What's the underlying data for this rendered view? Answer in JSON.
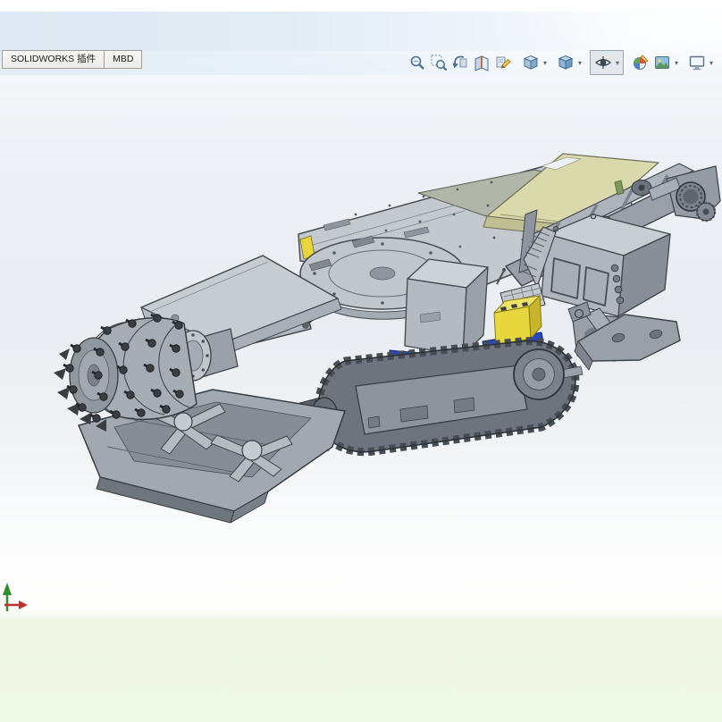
{
  "app": {
    "name": "SOLIDWORKS"
  },
  "command_tabs": {
    "plugins_tab": "SOLIDWORKS 插件",
    "mbd_tab": "MBD"
  },
  "headsup_toolbar": {
    "icons": [
      "zoom-to-fit",
      "zoom-to-area",
      "previous-view",
      "section-view",
      "annotation-views",
      "view-orientation",
      "display-style",
      "hide-show-items",
      "edit-appearance",
      "apply-scene",
      "view-settings"
    ],
    "pressed_icon": "hide-show-items",
    "dropdown_icons": [
      "view-orientation",
      "display-style",
      "hide-show-items",
      "apply-scene",
      "view-settings"
    ],
    "caret_glyph": "▾"
  },
  "viewport": {
    "background_top": "#e9eef4",
    "background_bottom": "#eef6e3",
    "triad": {
      "x_axis_color": "#c03030",
      "y_axis_color": "#2f8f2f"
    }
  },
  "model": {
    "subject": "roadheader tunneling machine 3D model",
    "colors": {
      "body_gray": "#b4bac2",
      "track_gray": "#6e747d",
      "accent_blue": "#2547c9",
      "accent_yellow": "#e8d63f",
      "canopy_khaki": "#d9d9ab"
    }
  }
}
